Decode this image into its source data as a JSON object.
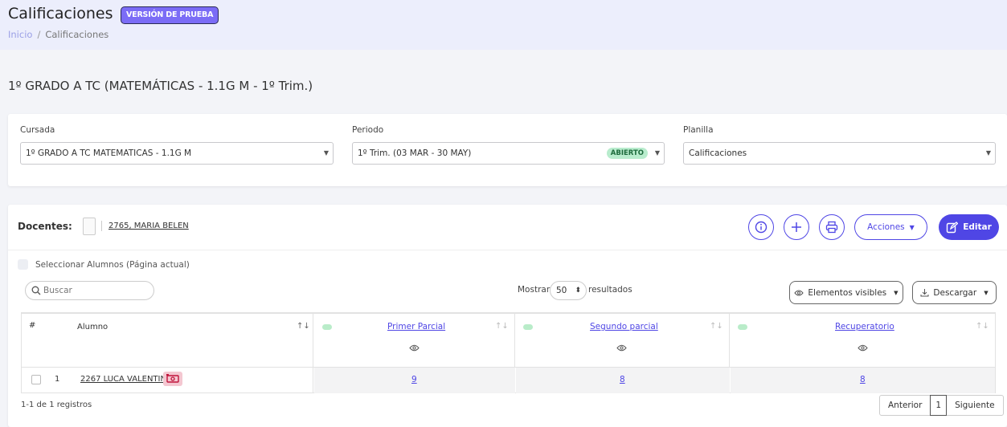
{
  "header": {
    "title": "Calificaciones",
    "badge": "VERSIÓN DE PRUEBA",
    "breadcrumb": {
      "home": "Inicio",
      "sep": "/",
      "current": "Calificaciones"
    }
  },
  "context_title": "1º GRADO A TC (MATEMÁTICAS - 1.1G M - 1º Trim.)",
  "filters": {
    "cursada": {
      "label": "Cursada",
      "value": "1º GRADO A TC MATEMATICAS - 1.1G M"
    },
    "periodo": {
      "label": "Periodo",
      "value": "1º Trim. (03 MAR - 30 MAY)",
      "status": "ABIERTO"
    },
    "planilla": {
      "label": "Planilla",
      "value": "Calificaciones"
    }
  },
  "docentes": {
    "label": "Docentes:",
    "teacher": "2765, MARIA BELEN"
  },
  "toolbar": {
    "acciones": "Acciones",
    "editar": "Editar"
  },
  "select_all": "Seleccionar Alumnos (Página actual)",
  "search": {
    "placeholder": "Buscar"
  },
  "length": {
    "prefix": "Mostrar",
    "value": "50",
    "suffix": "resultados"
  },
  "buttons": {
    "visibles": "Elementos visibles",
    "descargar": "Descargar"
  },
  "table": {
    "headers": {
      "num": "#",
      "alumno": "Alumno",
      "c1": "Primer Parcial",
      "c2": "Segundo parcial",
      "c3": "Recuperatorio"
    },
    "rows": [
      {
        "num": "1",
        "alumno": "2267 LUCA VALENTIN",
        "c1": "9",
        "c2": "8",
        "c3": "8"
      }
    ]
  },
  "footer": {
    "info": "1-1 de 1 registros",
    "prev": "Anterior",
    "page": "1",
    "next": "Siguiente"
  },
  "colors": {
    "accent": "#4f46e5",
    "badge": "#7b6cf6",
    "status_green": "#b8eccd"
  }
}
